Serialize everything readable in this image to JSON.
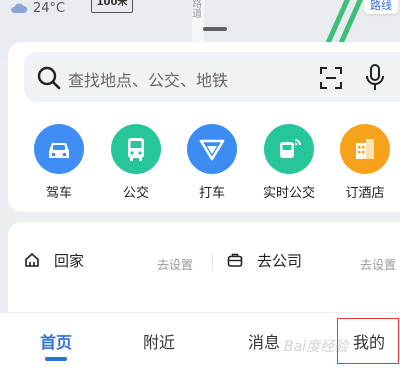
{
  "map": {
    "weather_temp": "24°C",
    "scale_label": "100米",
    "route_button": "路线",
    "road_label": "路道",
    "route_color": "#3cbf77"
  },
  "search": {
    "placeholder": "查找地点、公交、地铁",
    "icons": [
      "search-icon",
      "scan-icon",
      "mic-icon"
    ]
  },
  "quick_actions": [
    {
      "label": "驾车",
      "icon": "car-icon",
      "color": "#3f8ef5"
    },
    {
      "label": "公交",
      "icon": "bus-icon",
      "color": "#27c59a"
    },
    {
      "label": "打车",
      "icon": "taxi-icon",
      "color": "#3b8df2"
    },
    {
      "label": "实时公交",
      "icon": "realtime-bus-icon",
      "color": "#27c59a"
    },
    {
      "label": "订酒店",
      "icon": "hotel-icon",
      "color": "#f7a21b"
    }
  ],
  "places": {
    "home_label": "回家",
    "home_setup": "去设置",
    "work_label": "去公司",
    "work_setup": "去设置"
  },
  "tabs": [
    {
      "label": "首页",
      "active": true
    },
    {
      "label": "附近",
      "active": false
    },
    {
      "label": "消息",
      "active": false
    },
    {
      "label": "我的",
      "active": false
    }
  ],
  "colors": {
    "accent": "#2f6fdd",
    "highlight_box": "#e03a3a"
  }
}
